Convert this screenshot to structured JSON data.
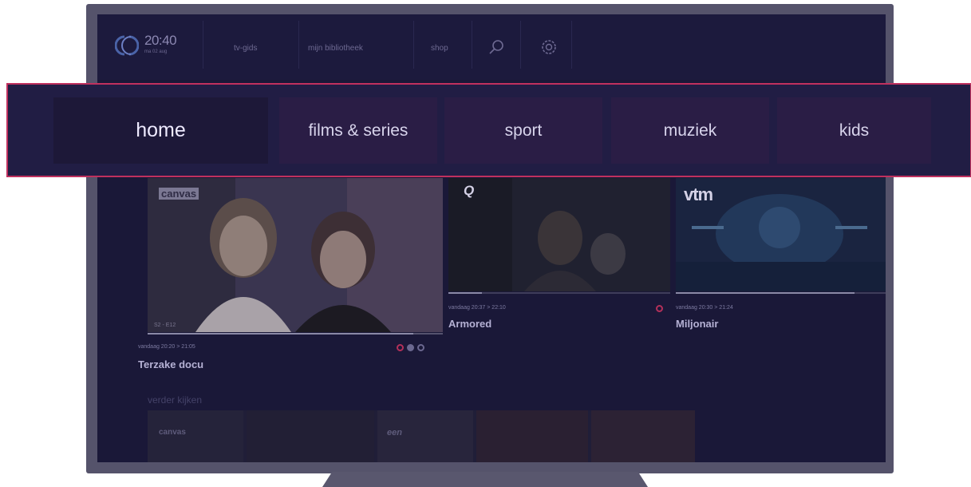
{
  "topbar": {
    "time": "20:40",
    "date": "ma 02 aug",
    "links": [
      "tv-gids",
      "mijn bibliotheek",
      "shop"
    ],
    "icons": [
      "search-icon",
      "gear-icon"
    ]
  },
  "menu": {
    "tabs": [
      {
        "label": "home",
        "active": true
      },
      {
        "label": "films & series",
        "active": false
      },
      {
        "label": "sport",
        "active": false
      },
      {
        "label": "muziek",
        "active": false
      },
      {
        "label": "kids",
        "active": false
      }
    ]
  },
  "tiles": [
    {
      "channel": "canvas",
      "episode": "S2 - E12",
      "meta": "vandaag  20:20 > 21:05",
      "title": "Terzake docu",
      "progress": 0.9
    },
    {
      "channel": "Q",
      "meta": "vandaag  20:37 > 22:10",
      "title": "Armored",
      "progress": 0.15
    },
    {
      "channel": "vtm",
      "meta": "vandaag  20:30 > 21:24",
      "title": "Miljonair",
      "progress": 0.85
    }
  ],
  "rows": {
    "continue_heading": "verder kijken",
    "continue_items": [
      "canvas",
      "een"
    ]
  },
  "colors": {
    "screen_bg": "#1a1838",
    "highlight_border": "#c0305e",
    "tv_frame": "#55536b"
  }
}
